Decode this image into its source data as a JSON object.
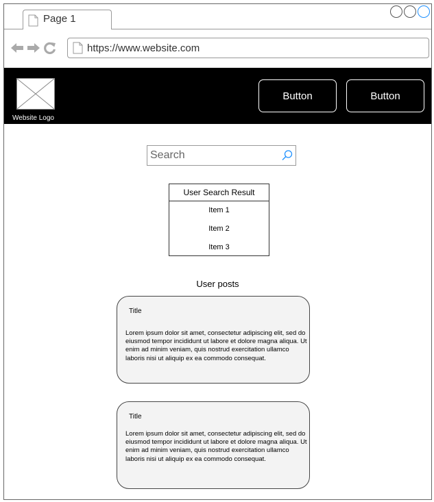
{
  "browser": {
    "tab_label": "Page 1",
    "url": "https://www.website.com"
  },
  "header": {
    "logo_label": "Website Logo",
    "buttons": [
      "Button",
      "Button"
    ]
  },
  "search": {
    "placeholder": "Search"
  },
  "results": {
    "header": "User Search Result",
    "items": [
      "Item 1",
      "Item 2",
      "Item 3"
    ]
  },
  "posts": {
    "heading": "User posts",
    "items": [
      {
        "title": "Title",
        "body": "Lorem ipsum dolor sit amet, consectetur adipiscing elit, sed do eiusmod tempor incididunt ut labore et dolore magna aliqua. Ut enim ad minim veniam, quis nostrud exercitation ullamco laboris nisi ut aliquip ex ea commodo consequat."
      },
      {
        "title": "Title",
        "body": "Lorem ipsum dolor sit amet, consectetur adipiscing elit, sed do eiusmod tempor incididunt ut labore et dolore magna aliqua. Ut enim ad minim veniam, quis nostrud exercitation ullamco laboris nisi ut aliquip ex ea commodo consequat."
      }
    ]
  },
  "icons": {
    "back": "back-arrow-icon",
    "forward": "forward-arrow-icon",
    "refresh": "refresh-icon",
    "page": "page-icon",
    "search": "search-icon",
    "logo": "image-placeholder-icon"
  },
  "colors": {
    "header_bg": "#000000",
    "post_bg": "#f3f3f3",
    "window_control_active": "#1e90ff"
  }
}
